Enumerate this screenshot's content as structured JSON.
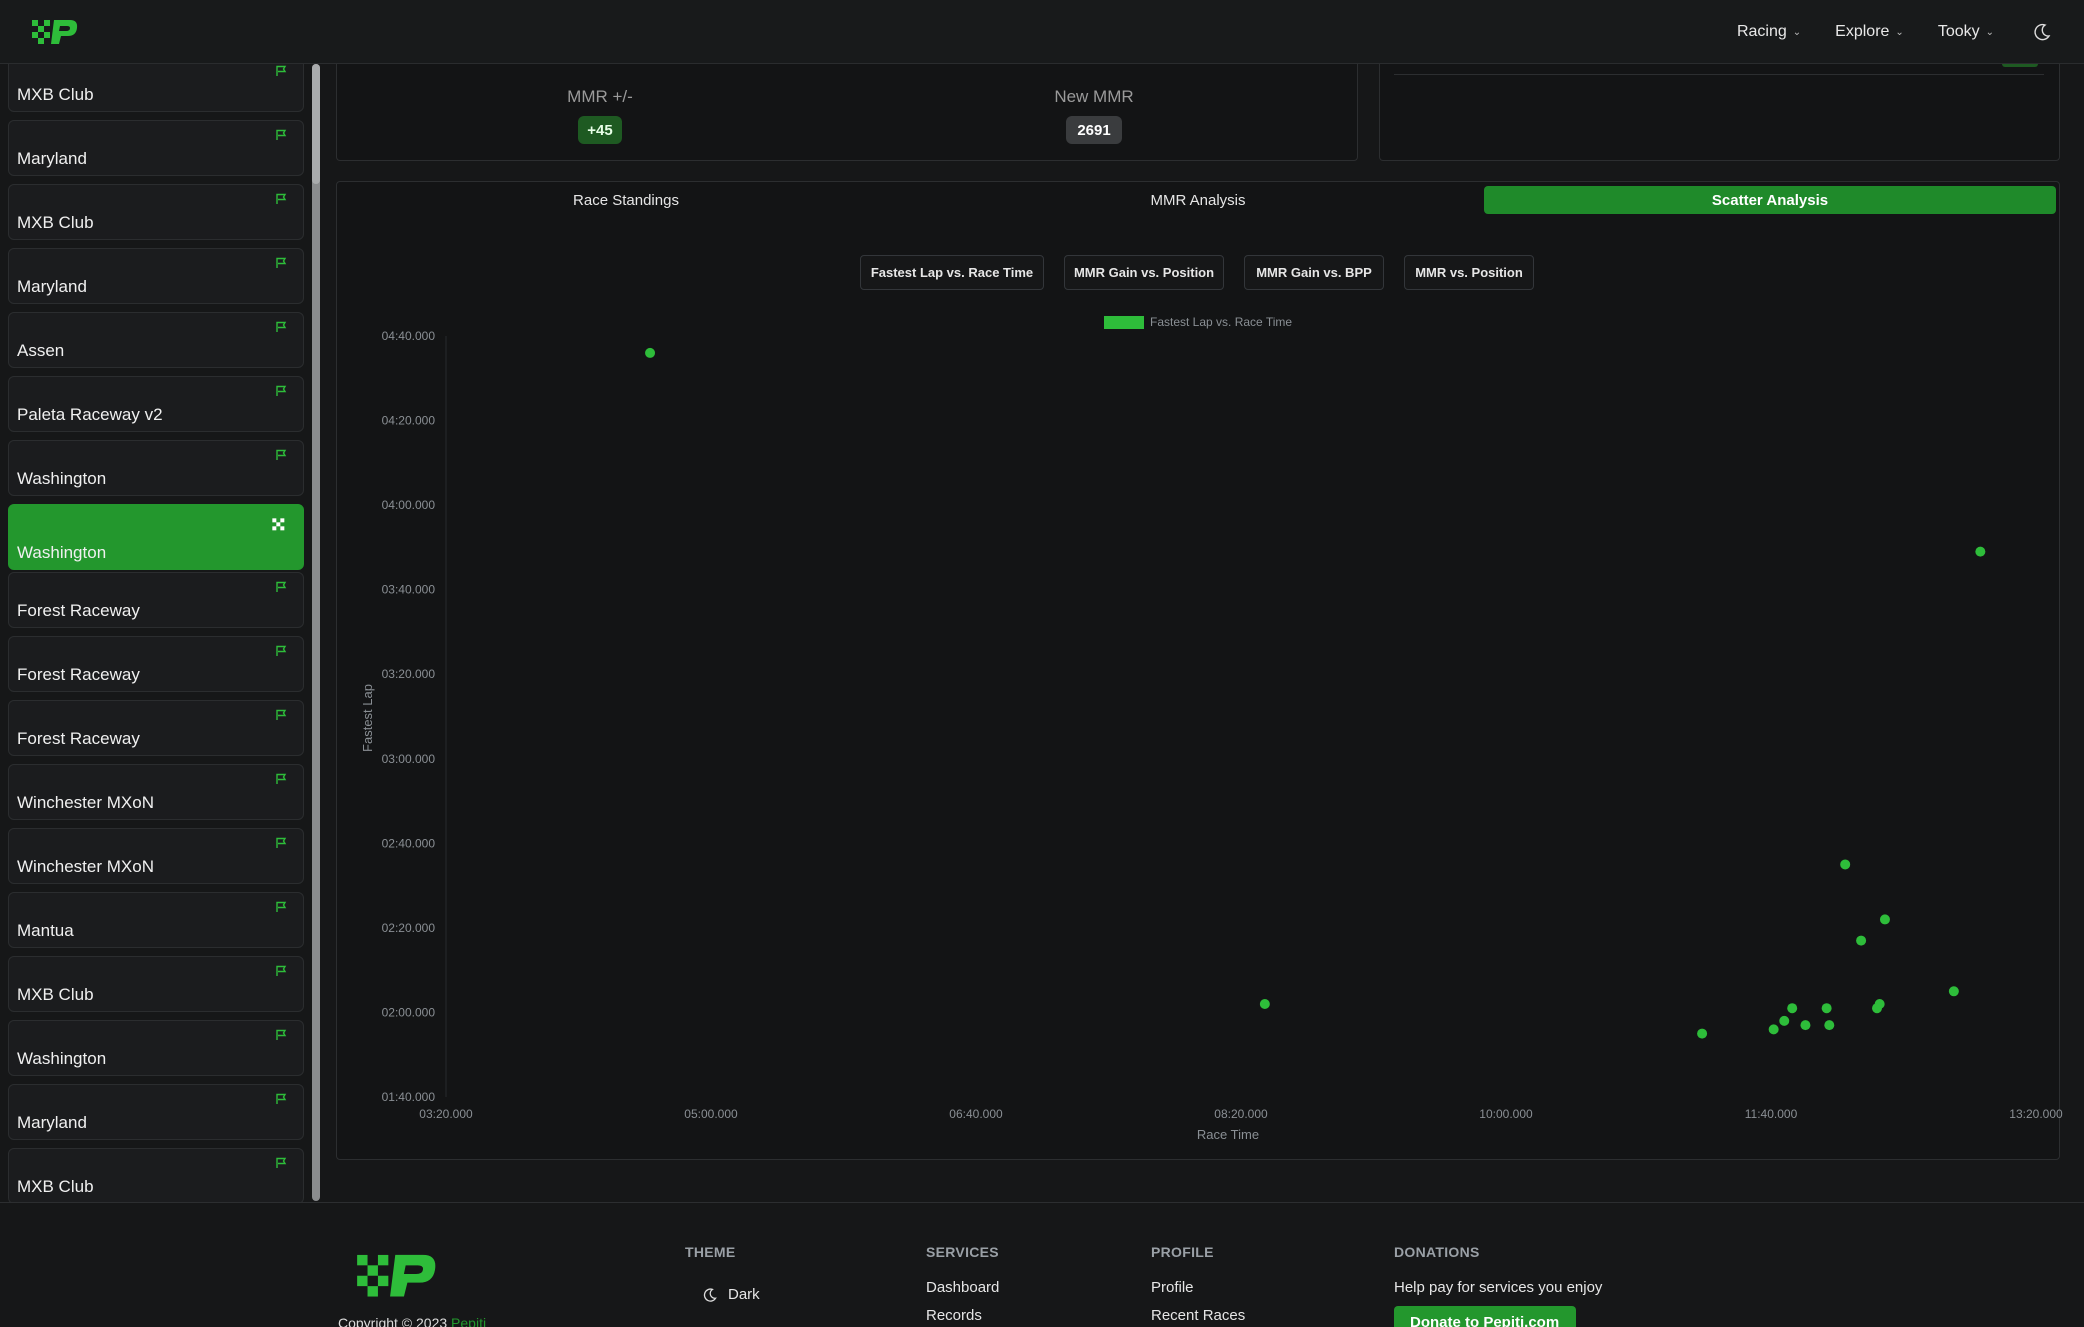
{
  "navbar": {
    "items": [
      {
        "label": "Racing"
      },
      {
        "label": "Explore"
      },
      {
        "label": "Tooky"
      }
    ]
  },
  "sidebar": {
    "tracks": [
      {
        "name": "MXB Club"
      },
      {
        "name": "Maryland"
      },
      {
        "name": "MXB Club"
      },
      {
        "name": "Maryland"
      },
      {
        "name": "Assen"
      },
      {
        "name": "Paleta Raceway v2"
      },
      {
        "name": "Washington"
      },
      {
        "name": "Washington"
      },
      {
        "name": "Forest Raceway"
      },
      {
        "name": "Forest Raceway"
      },
      {
        "name": "Forest Raceway"
      },
      {
        "name": "Winchester MXoN"
      },
      {
        "name": "Winchester MXoN"
      },
      {
        "name": "Mantua"
      },
      {
        "name": "MXB Club"
      },
      {
        "name": "Washington"
      },
      {
        "name": "Maryland"
      },
      {
        "name": "MXB Club"
      }
    ],
    "active_index": 7
  },
  "stats": {
    "mmr_change_label": "MMR +/-",
    "mmr_change_value": "+45",
    "new_mmr_label": "New MMR",
    "new_mmr_value": "2691"
  },
  "tabs": [
    {
      "label": "Race Standings"
    },
    {
      "label": "MMR Analysis"
    },
    {
      "label": "Scatter Analysis"
    }
  ],
  "subtabs": [
    {
      "label": "Fastest Lap vs. Race Time"
    },
    {
      "label": "MMR Gain vs. Position"
    },
    {
      "label": "MMR Gain vs. BPP"
    },
    {
      "label": "MMR vs. Position"
    }
  ],
  "chart_data": {
    "type": "scatter",
    "legend": "Fastest Lap vs. Race Time",
    "legend_position": "top-center",
    "xlabel": "Race Time",
    "ylabel": "Fastest Lap",
    "x_ticks": [
      "03:20.000",
      "05:00.000",
      "06:40.000",
      "08:20.000",
      "10:00.000",
      "11:40.000",
      "13:20.000"
    ],
    "y_ticks": [
      "04:40.000",
      "04:20.000",
      "04:00.000",
      "03:40.000",
      "03:20.000",
      "03:00.000",
      "02:40.000",
      "02:20.000",
      "02:00.000",
      "01:40.000"
    ],
    "xlim_seconds": [
      200,
      800
    ],
    "ylim_seconds": [
      100,
      280
    ],
    "grid": false,
    "color": "#2ebd3a",
    "points": [
      {
        "x": 277,
        "y": 276
      },
      {
        "x": 509,
        "y": 122
      },
      {
        "x": 674,
        "y": 115
      },
      {
        "x": 701,
        "y": 116
      },
      {
        "x": 705,
        "y": 118
      },
      {
        "x": 708,
        "y": 121
      },
      {
        "x": 713,
        "y": 117
      },
      {
        "x": 721,
        "y": 121
      },
      {
        "x": 722,
        "y": 117
      },
      {
        "x": 728,
        "y": 155
      },
      {
        "x": 734,
        "y": 137
      },
      {
        "x": 740,
        "y": 121
      },
      {
        "x": 741,
        "y": 122
      },
      {
        "x": 743,
        "y": 142
      },
      {
        "x": 769,
        "y": 125
      },
      {
        "x": 779,
        "y": 229
      }
    ]
  },
  "footer": {
    "theme_heading": "THEME",
    "theme_value": "Dark",
    "services_heading": "SERVICES",
    "services_links": [
      "Dashboard",
      "Records"
    ],
    "profile_heading": "PROFILE",
    "profile_links": [
      "Profile",
      "Recent Races"
    ],
    "donations_heading": "DONATIONS",
    "donations_text": "Help pay for services you enjoy",
    "donate_button": "Donate to Pepiti.com",
    "copyright_prefix": "Copyright © 2023",
    "copyright_brand": "Pepiti"
  }
}
